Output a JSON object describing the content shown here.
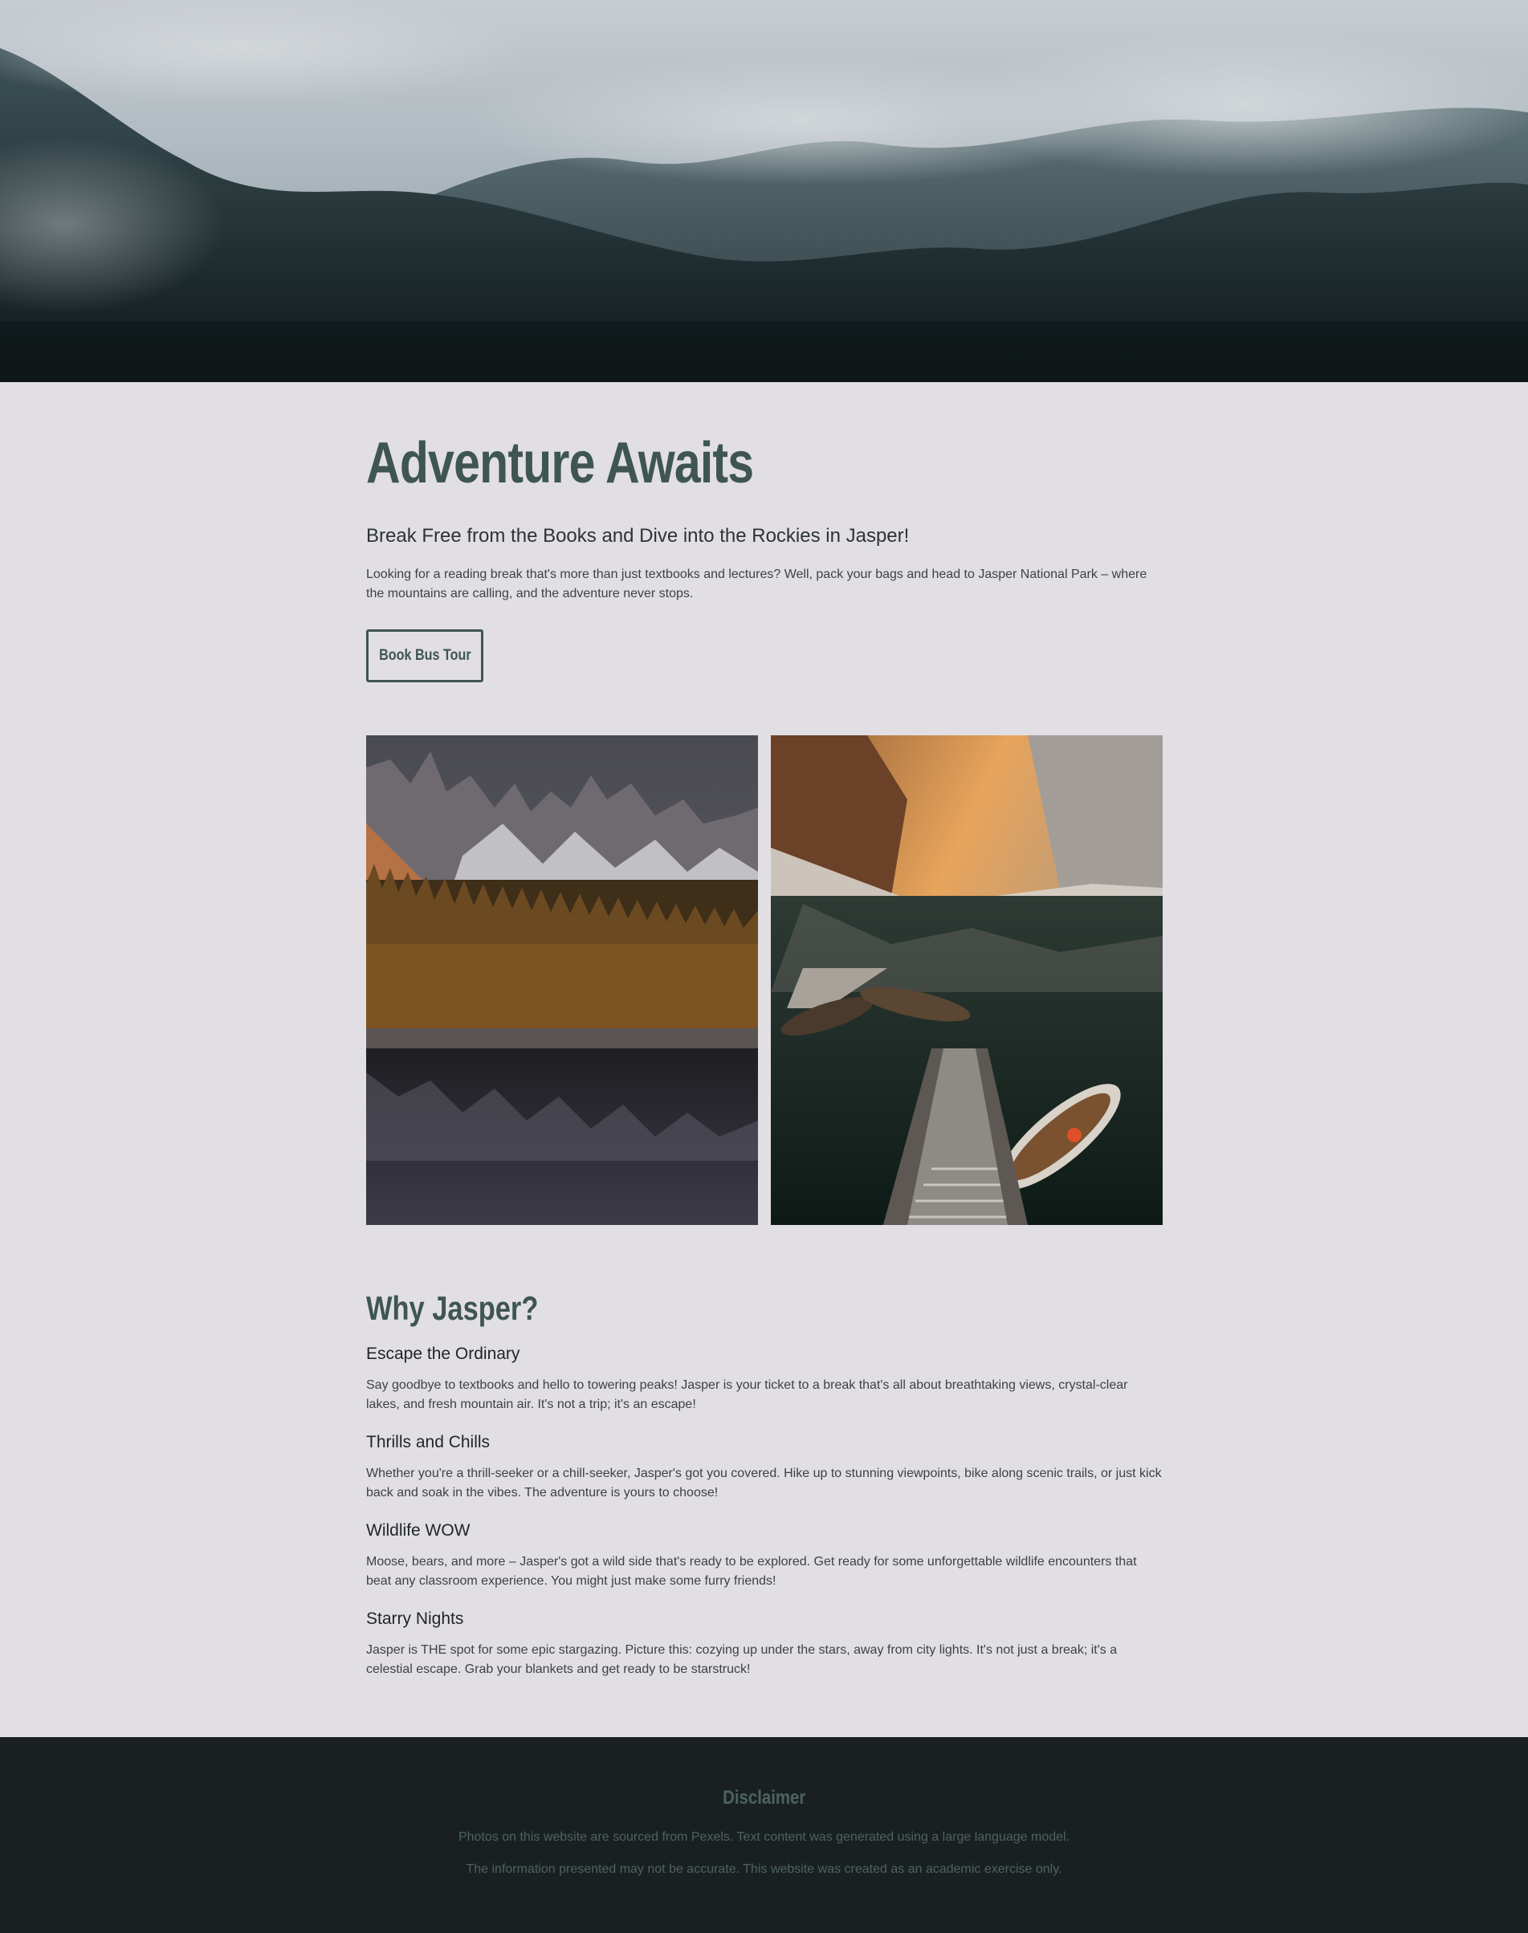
{
  "hero": {
    "image_description_icon": "misty-forest-mountains-image"
  },
  "main": {
    "title": "Adventure Awaits",
    "subtitle": "Break Free from the Books and Dive into the Rockies in Jasper!",
    "intro": "Looking for a reading break that's more than just textbooks and lectures? Well, pack your bags and head to Jasper National Park – where the mountains are calling, and the adventure never stops.",
    "cta_label": "Book Bus Tour"
  },
  "gallery": {
    "left_icon": "mountain-lake-forest-image",
    "right_icon": "lake-boats-dock-image"
  },
  "why": {
    "heading": "Why Jasper?",
    "features": [
      {
        "title": "Escape the Ordinary",
        "text": "Say goodbye to textbooks and hello to towering peaks! Jasper is your ticket to a break that's all about breathtaking views, crystal-clear lakes, and fresh mountain air. It's not a trip; it's an escape!"
      },
      {
        "title": "Thrills and Chills",
        "text": "Whether you're a thrill-seeker or a chill-seeker, Jasper's got you covered. Hike up to stunning viewpoints, bike along scenic trails, or just kick back and soak in the vibes. The adventure is yours to choose!"
      },
      {
        "title": "Wildlife WOW",
        "text": "Moose, bears, and more – Jasper's got a wild side that's ready to be explored. Get ready for some unforgettable wildlife encounters that beat any classroom experience. You might just make some furry friends!"
      },
      {
        "title": "Starry Nights",
        "text": "Jasper is THE spot for some epic stargazing. Picture this: cozying up under the stars, away from city lights. It's not just a break; it's a celestial escape. Grab your blankets and get ready to be starstruck!"
      }
    ]
  },
  "footer": {
    "heading": "Disclaimer",
    "line1": "Photos on this website are sourced from Pexels. Text content was generated using a large language model.",
    "line2": "The information presented may not be accurate. This website was created as an academic exercise only."
  },
  "colors": {
    "background": "#e1dfe4",
    "accent": "#3f5553",
    "footer": "#1a2022"
  }
}
